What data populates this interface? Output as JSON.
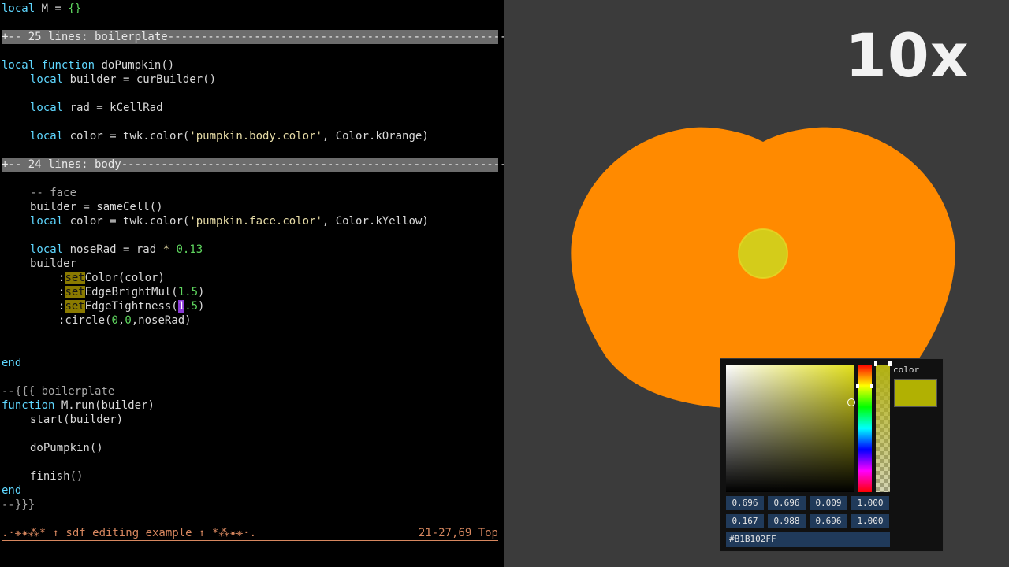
{
  "editor": {
    "lines": {
      "l1_kw": "local",
      "l1_rest": " M = ",
      "l1_br": "{}",
      "fold1": "+-- 25 lines: boilerplate---------------------------------------------------",
      "l4_kw1": "local",
      "l4_kw2": "function",
      "l4_rest": " doPumpkin()",
      "l5_kw": "local",
      "l5_rest": " builder = curBuilder()",
      "l7_kw": "local",
      "l7_rest": " rad = kCellRad",
      "l9_kw": "local",
      "l9_a": " color = twk.color(",
      "l9_str": "'pumpkin.body.color'",
      "l9_b": ", Color.kOrange)",
      "fold2": "+-- 24 lines: body----------------------------------------------------------",
      "l13": "-- face",
      "l14": "builder = sameCell()",
      "l15_kw": "local",
      "l15_a": " color = twk.color(",
      "l15_str": "'pumpkin.face.color'",
      "l15_b": ", Color.kYellow)",
      "l17_kw": "local",
      "l17_a": " noseRad = rad ",
      "l17_op": "*",
      "l17_num": "0.13",
      "l18": "builder",
      "l19_a": ":",
      "l19_hl": "set",
      "l19_b": "Color(color)",
      "l20_a": ":",
      "l20_hl": "set",
      "l20_b": "EdgeBrightMul(",
      "l20_num": "1.5",
      "l20_c": ")",
      "l21_a": ":",
      "l21_hl": "set",
      "l21_b": "EdgeTightness(",
      "l21_cur": "1",
      "l21_num": ".5",
      "l21_c": ")",
      "l22_a": ":circle(",
      "l22_n1": "0",
      "l22_c1": ",",
      "l22_n2": "0",
      "l22_b": ",noseRad)",
      "l25": "end",
      "l27": "--{{{ boilerplate",
      "l28_kw": "function",
      "l28_rest": " M.run(builder)",
      "l29": "start(builder)",
      "l31": "doPumpkin()",
      "l33": "finish()",
      "l34": "end",
      "l35": "--}}}"
    },
    "status_left": ".·❋✷⁂* ↑ sdf editing example ↑ *⁂✷❋·.",
    "status_right": "21-27,69 Top"
  },
  "viewport": {
    "speed_label": "10x",
    "pumpkin_color": "#ff8a00",
    "nose_color": "#d4cc1a"
  },
  "color_picker": {
    "label": "color",
    "swatch_color": "#B1B102",
    "row1": [
      "0.696",
      "0.696",
      "0.009",
      "1.000"
    ],
    "row2": [
      "0.167",
      "0.988",
      "0.696",
      "1.000"
    ],
    "hex": "#B1B102FF"
  }
}
